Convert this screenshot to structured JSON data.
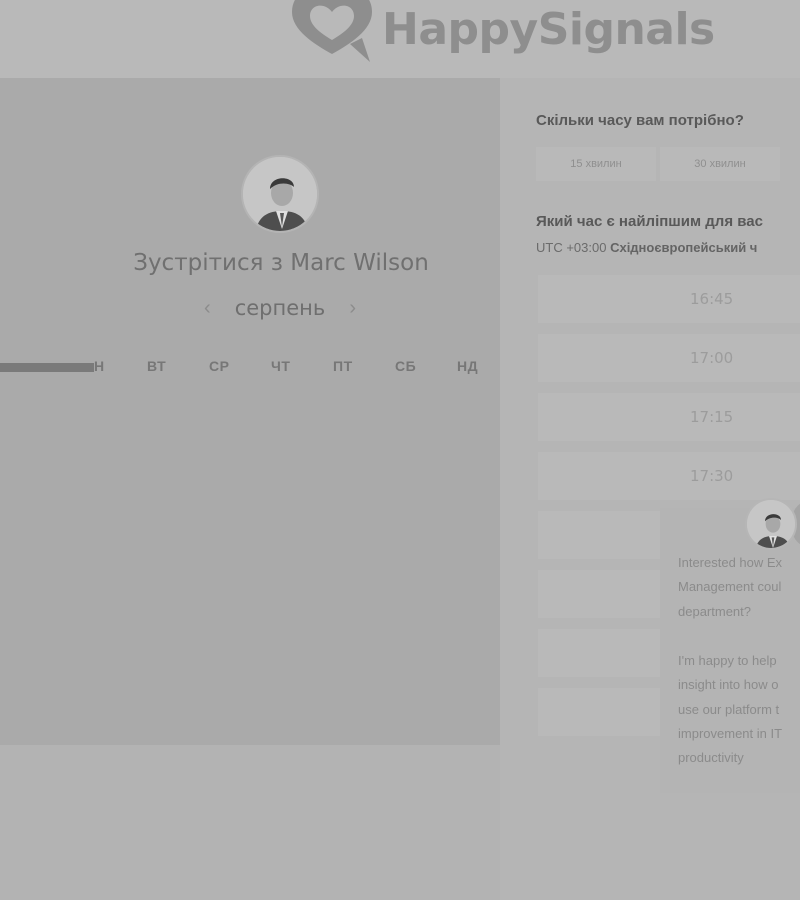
{
  "header": {
    "logo_text": "HappySignals"
  },
  "host": {
    "title": "Зустрітися з Marc Wilson"
  },
  "calendar": {
    "prev_icon": "chevron-left-icon",
    "next_icon": "chevron-right-icon",
    "prev_label": "‹",
    "next_label": "›",
    "month": "серпень",
    "weekdays": [
      "Н",
      "ВТ",
      "СР",
      "ЧТ",
      "ПТ",
      "СБ",
      "НД"
    ]
  },
  "duration": {
    "question": "Скільки часу вам потрібно?",
    "options": [
      "15 хвилин",
      "30 хвилин"
    ]
  },
  "time": {
    "question": "Який час є найліпшим для вас",
    "tz_offset": "UTC +03:00",
    "tz_name": "Східноєвропейський ч",
    "slots": [
      "16:45",
      "17:00",
      "17:15",
      "17:30"
    ]
  },
  "chat": {
    "lines": [
      "Interested how Ex",
      "Management coul",
      "department?",
      "I'm happy to help",
      "insight into how o",
      "use our platform t",
      "improvement in IT",
      "productivity"
    ]
  },
  "colors": {
    "overlay_gray": "#aaaaaa",
    "text_dark": "#595959"
  }
}
